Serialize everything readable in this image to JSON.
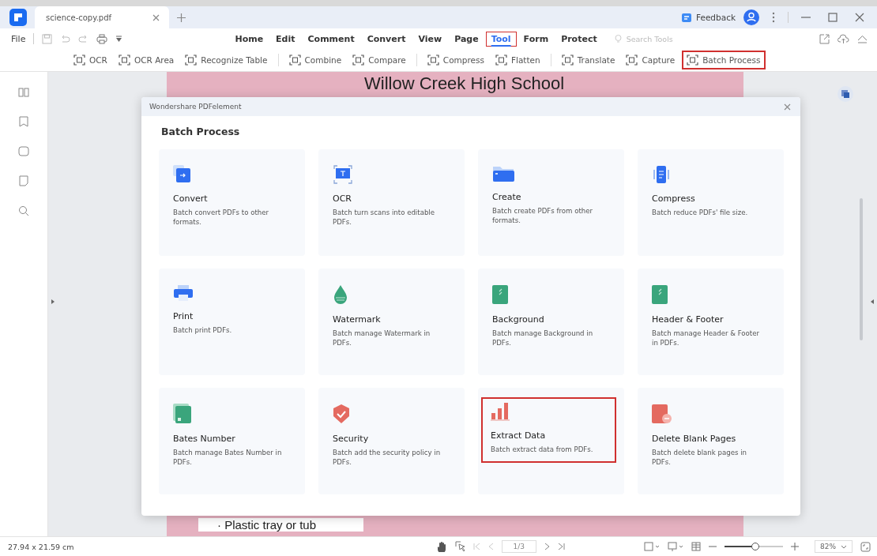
{
  "window": {
    "tab_title": "science-copy.pdf",
    "feedback": "Feedback"
  },
  "menu": {
    "file": "File",
    "tabs": [
      {
        "label": "Home",
        "selected": false
      },
      {
        "label": "Edit",
        "selected": false
      },
      {
        "label": "Comment",
        "selected": false
      },
      {
        "label": "Convert",
        "selected": false
      },
      {
        "label": "View",
        "selected": false
      },
      {
        "label": "Page",
        "selected": false
      },
      {
        "label": "Tool",
        "selected": true
      },
      {
        "label": "Form",
        "selected": false
      },
      {
        "label": "Protect",
        "selected": false
      }
    ],
    "search": {
      "placeholder": "Search Tools"
    }
  },
  "tool_groups": [
    [
      {
        "label": "OCR",
        "highlighted": false
      },
      {
        "label": "OCR Area",
        "highlighted": false
      },
      {
        "label": "Recognize Table",
        "highlighted": false
      }
    ],
    [
      {
        "label": "Combine",
        "highlighted": false
      },
      {
        "label": "Compare",
        "highlighted": false
      }
    ],
    [
      {
        "label": "Compress",
        "highlighted": false
      },
      {
        "label": "Flatten",
        "highlighted": false
      }
    ],
    [
      {
        "label": "Translate",
        "highlighted": false
      },
      {
        "label": "Capture",
        "highlighted": false
      },
      {
        "label": "Batch Process",
        "highlighted": true
      }
    ]
  ],
  "document": {
    "heading": "Willow Creek High School",
    "bullet": "· Plastic tray or tub"
  },
  "dialog": {
    "app_name": "Wondershare PDFelement",
    "title": "Batch Process",
    "cards": [
      {
        "kind": "convert",
        "title": "Convert",
        "description": "Batch convert PDFs to other formats.",
        "highlighted": false
      },
      {
        "kind": "ocr",
        "title": "OCR",
        "description": "Batch turn scans into editable PDFs.",
        "highlighted": false
      },
      {
        "kind": "create",
        "title": "Create",
        "description": "Batch create PDFs from other formats.",
        "highlighted": false
      },
      {
        "kind": "compress",
        "title": "Compress",
        "description": "Batch reduce PDFs' file size.",
        "highlighted": false
      },
      {
        "kind": "print",
        "title": "Print",
        "description": "Batch print PDFs.",
        "highlighted": false
      },
      {
        "kind": "watermark",
        "title": "Watermark",
        "description": "Batch manage Watermark  in PDFs.",
        "highlighted": false
      },
      {
        "kind": "background",
        "title": "Background",
        "description": "Batch manage Background in PDFs.",
        "highlighted": false
      },
      {
        "kind": "header",
        "title": "Header & Footer",
        "description": "Batch manage Header & Footer in PDFs.",
        "highlighted": false
      },
      {
        "kind": "bates",
        "title": "Bates Number",
        "description": "Batch manage Bates Number in PDFs.",
        "highlighted": false
      },
      {
        "kind": "security",
        "title": "Security",
        "description": "Batch add the security policy in PDFs.",
        "highlighted": false
      },
      {
        "kind": "extract",
        "title": "Extract Data",
        "description": "Batch extract data from PDFs.",
        "highlighted": true
      },
      {
        "kind": "delete",
        "title": "Delete Blank Pages",
        "description": "Batch delete blank pages in PDFs.",
        "highlighted": false
      }
    ]
  },
  "status_bar": {
    "page_size": "27.94 x 21.59 cm",
    "page": "1/3",
    "zoom": "82%",
    "zoom_level": {
      "level": 0.53
    }
  }
}
